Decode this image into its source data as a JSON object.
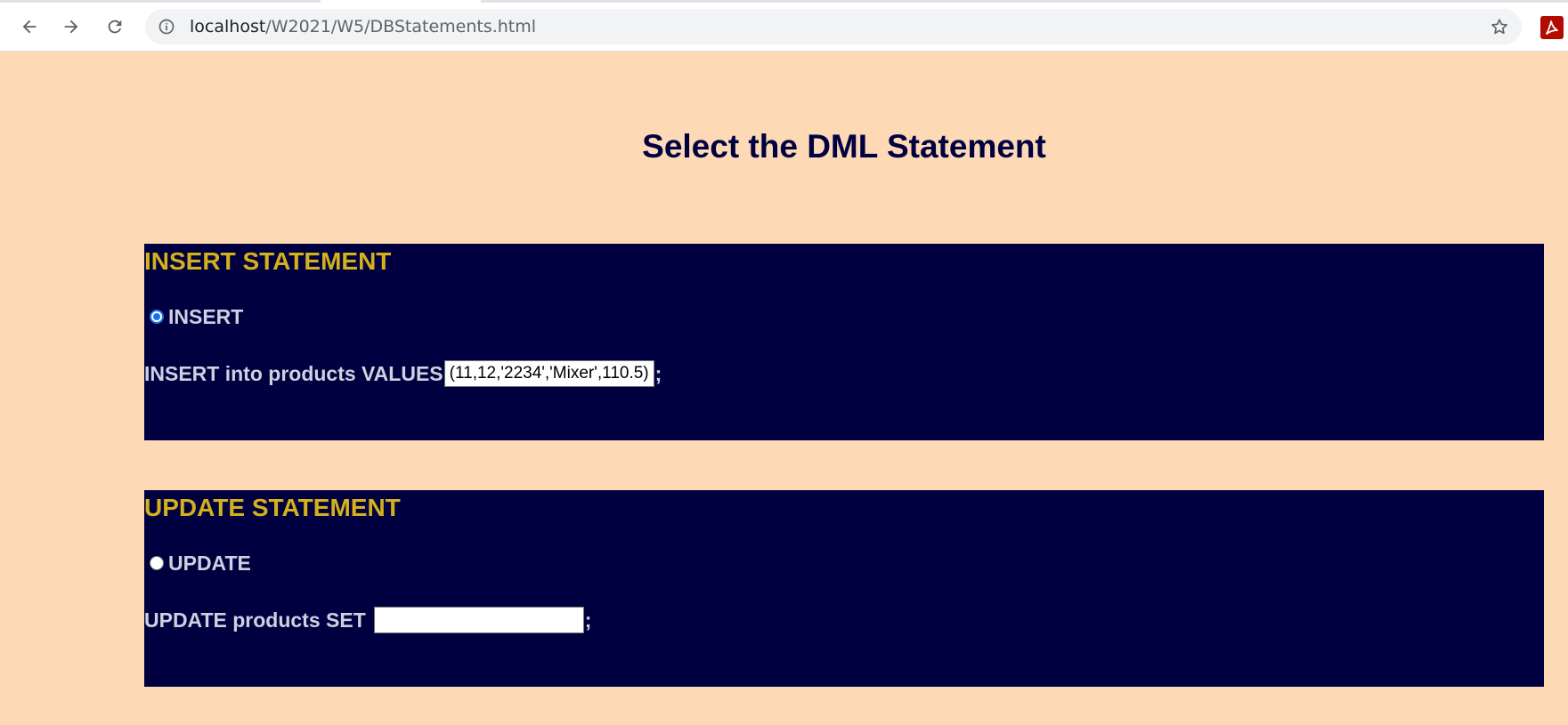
{
  "browser": {
    "url_host": "localhost",
    "url_path": "/W2021/W5/DBStatements.html"
  },
  "page": {
    "title": "Select the DML Statement"
  },
  "insert": {
    "heading": "INSERT STATEMENT",
    "radio_label": "INSERT",
    "radio_checked": true,
    "statement_prefix": "INSERT into products VALUES",
    "input_value": "(11,12,'2234','Mixer',110.5)",
    "suffix": ";"
  },
  "update": {
    "heading": "UPDATE STATEMENT",
    "radio_label": "UPDATE",
    "radio_checked": false,
    "statement_prefix": "UPDATE products SET",
    "input_value": "",
    "suffix": ";"
  },
  "colors": {
    "page_background": "#fdd9b5",
    "panel_background": "#000040",
    "heading_gold": "#d4b11a",
    "panel_text": "#d0d0e0",
    "title_navy": "#000040",
    "radio_accent": "#1a73e8"
  },
  "icons": {
    "back": "back-arrow-icon",
    "forward": "forward-arrow-icon",
    "reload": "reload-icon",
    "site_info": "info-icon",
    "bookmark": "star-icon",
    "extension": "pdf-extension-icon"
  }
}
